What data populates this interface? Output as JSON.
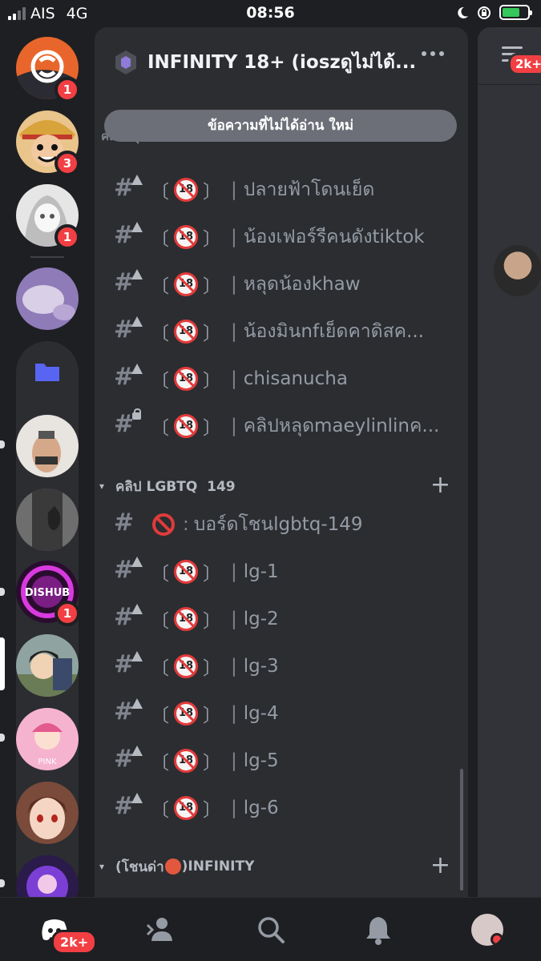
{
  "status_bar": {
    "carrier": "AIS",
    "network": "4G",
    "time": "08:56"
  },
  "server": {
    "name": "INFINITY 18+ (ioszดูไม่ได้..."
  },
  "unread_banner": "ข้อความที่ไม่ได้อ่าน ใหม่",
  "hidden_category": "คลิปหลุด คนดัง 149 (ภาพเบลอ) ห้องนี้",
  "age_label": "18",
  "channels_top": [
    {
      "name": "ปลายฟ้าโดนเย็ด",
      "icon": "warning"
    },
    {
      "name": "น้องเฟอร์รีคนดังtiktok",
      "icon": "warning"
    },
    {
      "name": "หลุดน้องkhaw",
      "icon": "warning"
    },
    {
      "name": "น้องมินnfเย็ดคาดิสค...",
      "icon": "warning"
    },
    {
      "name": "chisanucha",
      "icon": "warning"
    },
    {
      "name": "คลิปหลุดmaeylinlinค...",
      "icon": "lock"
    }
  ],
  "category_lgbtq": {
    "label": "คลิป LGBTQ  149"
  },
  "lgbtq_board": {
    "separator": ":",
    "name": "บอร์ดโชนlgbtq-149"
  },
  "lgbtq_channels": [
    "lg-1",
    "lg-2",
    "lg-3",
    "lg-4",
    "lg-5",
    "lg-6"
  ],
  "category_infinity": {
    "label_pre": "(โชนด่า",
    "label_post": ")INFINITY"
  },
  "guild_badges": [
    "1",
    "3",
    "1",
    "1"
  ],
  "peek_badge": "2k+",
  "tab_badge": "2k+",
  "colors": {
    "accent_red": "#f23f43",
    "panel": "#2b2d31",
    "rail": "#1e1f22"
  }
}
